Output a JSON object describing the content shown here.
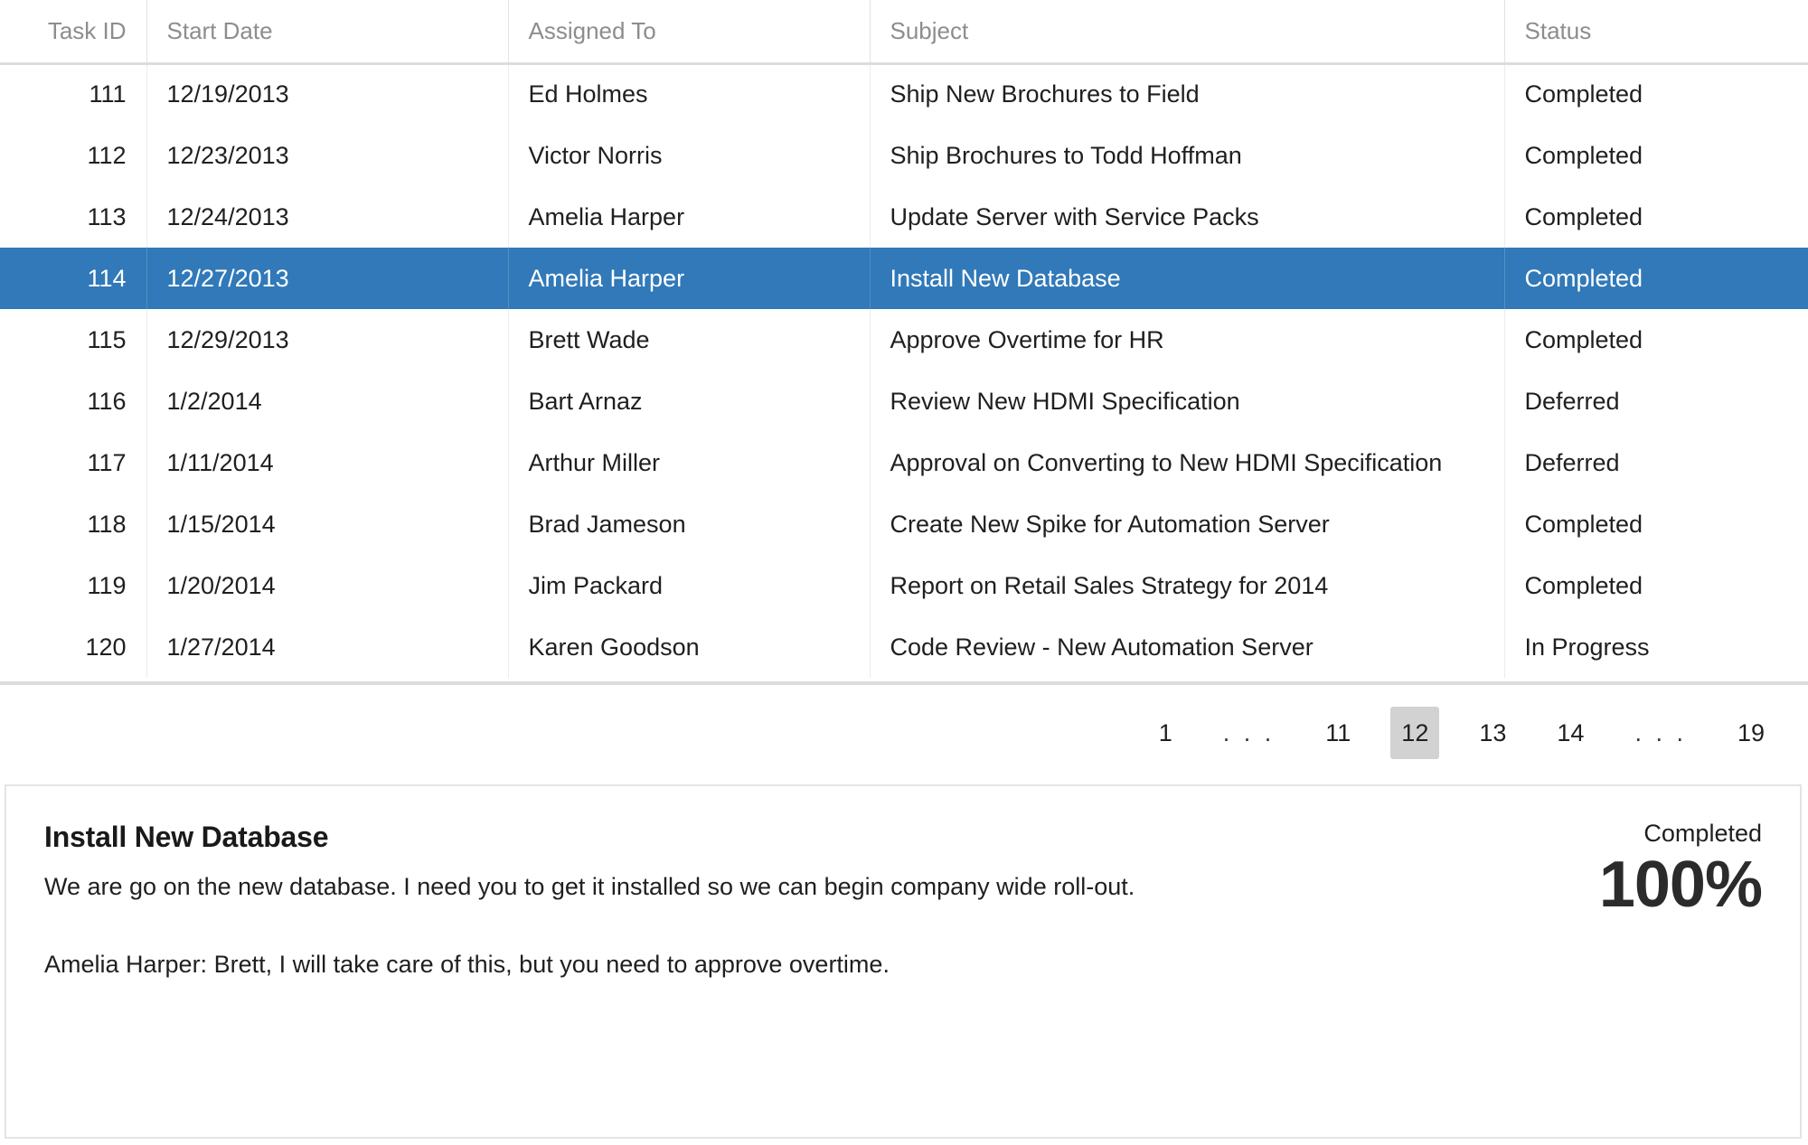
{
  "grid": {
    "columns": [
      {
        "key": "task_id",
        "label": "Task ID"
      },
      {
        "key": "start_date",
        "label": "Start Date"
      },
      {
        "key": "assigned_to",
        "label": "Assigned To"
      },
      {
        "key": "subject",
        "label": "Subject"
      },
      {
        "key": "status",
        "label": "Status"
      }
    ],
    "rows": [
      {
        "task_id": "111",
        "start_date": "12/19/2013",
        "assigned_to": "Ed Holmes",
        "subject": "Ship New Brochures to Field",
        "status": "Completed",
        "selected": false
      },
      {
        "task_id": "112",
        "start_date": "12/23/2013",
        "assigned_to": "Victor Norris",
        "subject": "Ship Brochures to Todd Hoffman",
        "status": "Completed",
        "selected": false
      },
      {
        "task_id": "113",
        "start_date": "12/24/2013",
        "assigned_to": "Amelia Harper",
        "subject": "Update Server with Service Packs",
        "status": "Completed",
        "selected": false
      },
      {
        "task_id": "114",
        "start_date": "12/27/2013",
        "assigned_to": "Amelia Harper",
        "subject": "Install New Database",
        "status": "Completed",
        "selected": true
      },
      {
        "task_id": "115",
        "start_date": "12/29/2013",
        "assigned_to": "Brett Wade",
        "subject": "Approve Overtime for HR",
        "status": "Completed",
        "selected": false
      },
      {
        "task_id": "116",
        "start_date": "1/2/2014",
        "assigned_to": "Bart Arnaz",
        "subject": "Review New HDMI Specification",
        "status": "Deferred",
        "selected": false
      },
      {
        "task_id": "117",
        "start_date": "1/11/2014",
        "assigned_to": "Arthur Miller",
        "subject": "Approval on Converting to New HDMI Specification",
        "status": "Deferred",
        "selected": false
      },
      {
        "task_id": "118",
        "start_date": "1/15/2014",
        "assigned_to": "Brad Jameson",
        "subject": "Create New Spike for Automation Server",
        "status": "Completed",
        "selected": false
      },
      {
        "task_id": "119",
        "start_date": "1/20/2014",
        "assigned_to": "Jim Packard",
        "subject": "Report on Retail Sales Strategy for 2014",
        "status": "Completed",
        "selected": false
      },
      {
        "task_id": "120",
        "start_date": "1/27/2014",
        "assigned_to": "Karen Goodson",
        "subject": "Code Review - New Automation Server",
        "status": "In Progress",
        "selected": false
      }
    ]
  },
  "pager": {
    "items": [
      {
        "label": "1",
        "type": "page",
        "active": false
      },
      {
        "label": ". . .",
        "type": "ellipsis",
        "active": false
      },
      {
        "label": "11",
        "type": "page",
        "active": false
      },
      {
        "label": "12",
        "type": "page",
        "active": true
      },
      {
        "label": "13",
        "type": "page",
        "active": false
      },
      {
        "label": "14",
        "type": "page",
        "active": false
      },
      {
        "label": ". . .",
        "type": "ellipsis",
        "active": false
      },
      {
        "label": "19",
        "type": "page",
        "active": false
      }
    ],
    "current_page": "12"
  },
  "detail": {
    "title": "Install New Database",
    "paragraph_1": "We are go on the new database. I need you to get it installed so we can begin company wide roll-out.",
    "paragraph_2": "Amelia Harper: Brett, I will take care of this, but you need to approve overtime.",
    "status_label": "Completed",
    "status_value": "100%"
  },
  "colors": {
    "selection_blue": "#3179b8",
    "pager_active_bg": "#d2d2d2",
    "header_text": "#8d8d8d",
    "grid_line": "#ececec",
    "panel_border": "#e4e4e4"
  }
}
